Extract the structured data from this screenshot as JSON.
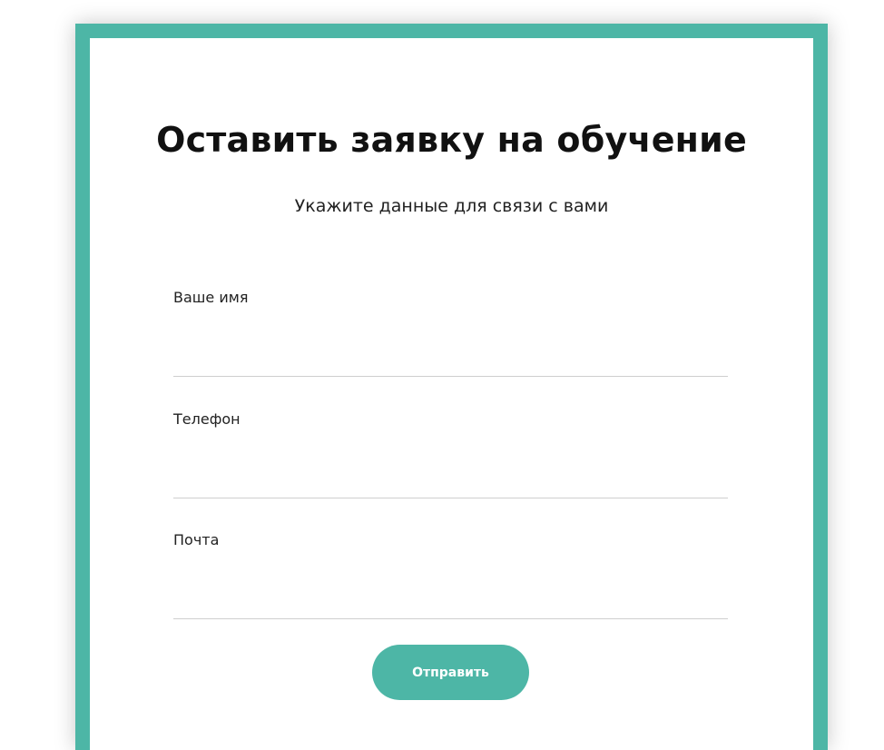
{
  "colors": {
    "accent": "#4db6a6",
    "background": "#ffffff",
    "divider": "#cfcfcf"
  },
  "form": {
    "title": "Оставить заявку на обучение",
    "subtitle": "Укажите данные для связи с вами",
    "fields": [
      {
        "label": "Ваше имя",
        "value": "",
        "placeholder": ""
      },
      {
        "label": "Телефон",
        "value": "",
        "placeholder": ""
      },
      {
        "label": "Почта",
        "value": "",
        "placeholder": ""
      }
    ],
    "submit_label": "Отправить"
  }
}
